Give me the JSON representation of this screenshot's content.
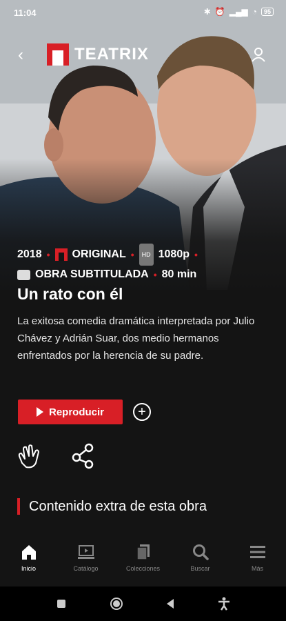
{
  "status_bar": {
    "time": "11:04",
    "battery": "95"
  },
  "header": {
    "brand": "TEATRIX"
  },
  "show": {
    "year": "2018",
    "original": "ORIGINAL",
    "quality": "1080p",
    "hd_badge": "HD",
    "subtitle_label": "OBRA SUBTITULADA",
    "duration": "80 min",
    "title": "Un rato con él",
    "description": "La exitosa comedia dramática interpretada por Julio Chávez y Adrián Suar, dos medio hermanos enfrentados por la herencia de su padre."
  },
  "actions": {
    "play_label": "Reproducir",
    "add_label": "+"
  },
  "extra_section": {
    "title": "Contenido extra de esta obra"
  },
  "bottom_nav": [
    {
      "label": "Inicio",
      "icon": "home-icon",
      "active": true
    },
    {
      "label": "Catálogo",
      "icon": "catalog-icon",
      "active": false
    },
    {
      "label": "Colecciones",
      "icon": "collections-icon",
      "active": false
    },
    {
      "label": "Buscar",
      "icon": "search-icon",
      "active": false
    },
    {
      "label": "Más",
      "icon": "menu-icon",
      "active": false
    }
  ],
  "colors": {
    "accent": "#d81f26",
    "background": "#141414"
  }
}
